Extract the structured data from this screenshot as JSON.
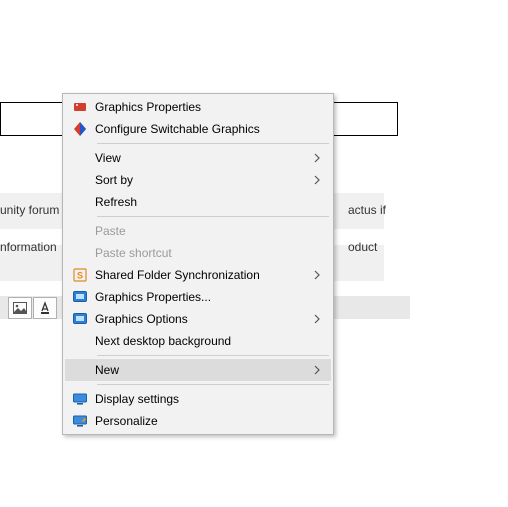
{
  "background": {
    "forum_line1_left": "unity forum",
    "forum_line1_right": "actus if",
    "forum_line2_left": "nformation",
    "forum_line2_right": "oduct"
  },
  "menu": {
    "items": {
      "gp": {
        "label": "Graphics Properties"
      },
      "csg": {
        "label": "Configure Switchable Graphics"
      },
      "view": {
        "label": "View"
      },
      "sort": {
        "label": "Sort by"
      },
      "refresh": {
        "label": "Refresh"
      },
      "paste": {
        "label": "Paste"
      },
      "paste_shortcut": {
        "label": "Paste shortcut"
      },
      "sfs": {
        "label": "Shared Folder Synchronization"
      },
      "gp2": {
        "label": "Graphics Properties..."
      },
      "go": {
        "label": "Graphics Options"
      },
      "ndb": {
        "label": "Next desktop background"
      },
      "new": {
        "label": "New"
      },
      "ds": {
        "label": "Display settings"
      },
      "pers": {
        "label": "Personalize"
      }
    }
  }
}
